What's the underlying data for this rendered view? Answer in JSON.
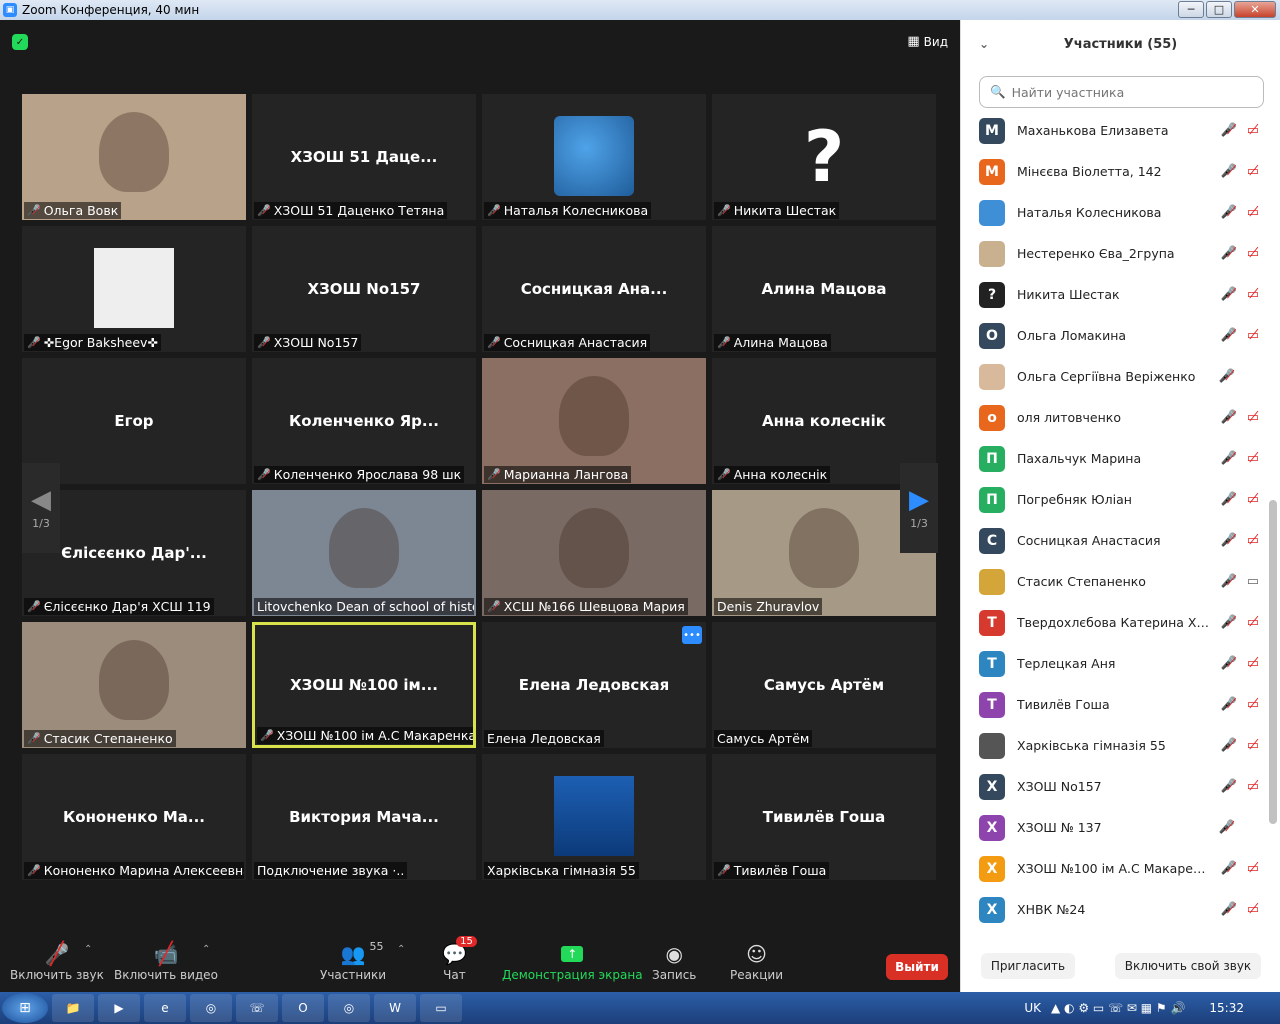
{
  "window": {
    "title": "Zoom Конференция, 40 мин",
    "min": "─",
    "max": "□",
    "close": "✕"
  },
  "view_label": "Вид",
  "pager": {
    "left_label": "1/3",
    "right_label": "1/3"
  },
  "tiles": [
    {
      "big": "",
      "label": "Ольга Вовк",
      "muted": true,
      "video": true,
      "bg": "#b8a28a"
    },
    {
      "big": "ХЗОШ 51 Даце...",
      "label": "ХЗОШ 51 Даценко Тетяна",
      "muted": true
    },
    {
      "big": "",
      "label": "Наталья Колесникова",
      "muted": true,
      "avatar": "globe"
    },
    {
      "big": "?",
      "label": "Никита Шестак",
      "muted": true
    },
    {
      "big": "",
      "label": "✜Egor Baksheev✜",
      "muted": true,
      "avatar": "manga"
    },
    {
      "big": "ХЗОШ No157",
      "label": "ХЗОШ No157",
      "muted": true
    },
    {
      "big": "Сосницкая  Ана...",
      "label": "Сосницкая Анастасия",
      "muted": true
    },
    {
      "big": "Алина Мацова",
      "label": "Алина Мацова",
      "muted": true
    },
    {
      "big": "Егор",
      "label": "Егор",
      "muted": false
    },
    {
      "big": "Коленченко  Яр...",
      "label": "Коленченко Ярослава 98 шк",
      "muted": true
    },
    {
      "big": "",
      "label": "Марианна Лангова",
      "muted": true,
      "video": true,
      "bg": "#8a6f62"
    },
    {
      "big": "Анна колеснік",
      "label": "Анна колеснік",
      "muted": true
    },
    {
      "big": "Єлісєєнко  Дар'...",
      "label": "Єлісєєнко Дар'я ХСШ 119",
      "muted": true
    },
    {
      "big": "",
      "label": "Litovchenko Dean of school of histo...",
      "muted": false,
      "video": true,
      "bg": "#7d8693"
    },
    {
      "big": "",
      "label": "ХСШ №166 Шевцова Мария",
      "muted": true,
      "video": true,
      "bg": "#7a6a64"
    },
    {
      "big": "",
      "label": "Denis Zhuravlov",
      "muted": false,
      "video": true,
      "bg": "#a69a86"
    },
    {
      "big": "",
      "label": "Стасик Степаненко",
      "muted": true,
      "video": true,
      "bg": "#9c8c7c"
    },
    {
      "big": "ХЗОШ  №100 ім...",
      "label": "ХЗОШ №100 ім А.С Макаренка...",
      "muted": true,
      "active": true
    },
    {
      "big": "Елена Ледовская",
      "label": "Елена Ледовская",
      "muted": false,
      "more": true
    },
    {
      "big": "Самусь Артём",
      "label": "Самусь Артём",
      "muted": false
    },
    {
      "big": "Кононенко  Ма...",
      "label": "Кононенко Марина Алексеевна",
      "muted": true
    },
    {
      "big": "Виктория  Мача...",
      "label": "Подключение звука ·..",
      "muted": false
    },
    {
      "big": "",
      "label": "Харківська гімназія 55",
      "muted": false,
      "avatar": "photo"
    },
    {
      "big": "Тивилёв Гоша",
      "label": "Тивилёв Гоша",
      "muted": true
    }
  ],
  "toolbar": {
    "mute_label": "Включить звук",
    "video_label": "Включить видео",
    "participants_label": "Участники",
    "participants_count": "55",
    "chat_label": "Чат",
    "chat_badge": "15",
    "share_label": "Демонстрация экрана",
    "record_label": "Запись",
    "reactions_label": "Реакции",
    "leave_label": "Выйти"
  },
  "panel": {
    "title": "Участники (55)",
    "search_placeholder": "Найти участника",
    "invite_label": "Пригласить",
    "unmute_self_label": "Включить свой звук"
  },
  "participants": [
    {
      "initial": "М",
      "name": "Маханькова Елизавета",
      "color": "#34495e",
      "cam": "off"
    },
    {
      "initial": "М",
      "name": "Мінєєва Віолетта, 142",
      "color": "#e8671c",
      "cam": "off"
    },
    {
      "initial": "",
      "name": "Наталья Колесникова",
      "color": "#3f8fd6",
      "cam": "off"
    },
    {
      "initial": "",
      "name": "Нестеренко Єва_2група",
      "color": "#c9b08f",
      "cam": "off"
    },
    {
      "initial": "?",
      "name": "Никита Шестак",
      "color": "#222222",
      "cam": "off"
    },
    {
      "initial": "О",
      "name": "Ольга Ломакина",
      "color": "#34495e",
      "cam": "off"
    },
    {
      "initial": "",
      "name": "Ольга Сергіївна Веріженко",
      "color": "#d8b99c",
      "cam": "none"
    },
    {
      "initial": "о",
      "name": "оля литовченко",
      "color": "#e8671c",
      "cam": "off"
    },
    {
      "initial": "П",
      "name": "Пахальчук Марина",
      "color": "#27ae60",
      "cam": "off"
    },
    {
      "initial": "П",
      "name": "Погребняк Юліан",
      "color": "#27ae60",
      "cam": "off"
    },
    {
      "initial": "С",
      "name": "Сосницкая Анастасия",
      "color": "#34495e",
      "cam": "off"
    },
    {
      "initial": "",
      "name": "Стасик Степаненко",
      "color": "#d4a63a",
      "cam": "on"
    },
    {
      "initial": "Т",
      "name": "Твердохлєбова Катерина ХЗО...",
      "color": "#d63a2e",
      "cam": "off"
    },
    {
      "initial": "Т",
      "name": "Терлецкая Аня",
      "color": "#2e86c1",
      "cam": "off"
    },
    {
      "initial": "Т",
      "name": "Тивилёв Гоша",
      "color": "#8e44ad",
      "cam": "off"
    },
    {
      "initial": "",
      "name": "Харківська гімназія 55",
      "color": "#555555",
      "cam": "off"
    },
    {
      "initial": "Х",
      "name": "ХЗОШ No157",
      "color": "#34495e",
      "cam": "off"
    },
    {
      "initial": "Х",
      "name": "ХЗОШ № 137",
      "color": "#8e44ad",
      "cam": "none"
    },
    {
      "initial": "Х",
      "name": "ХЗОШ №100 ім А.С Макаренк...",
      "color": "#f39c12",
      "cam": "off"
    },
    {
      "initial": "Х",
      "name": "ХНВК №24",
      "color": "#2e86c1",
      "cam": "off"
    }
  ],
  "taskbar": {
    "lang": "UK",
    "clock": "15:32",
    "apps": [
      "📁",
      "▶",
      "e",
      "◎",
      "☏",
      "O",
      "◎",
      "W",
      "▭"
    ]
  }
}
